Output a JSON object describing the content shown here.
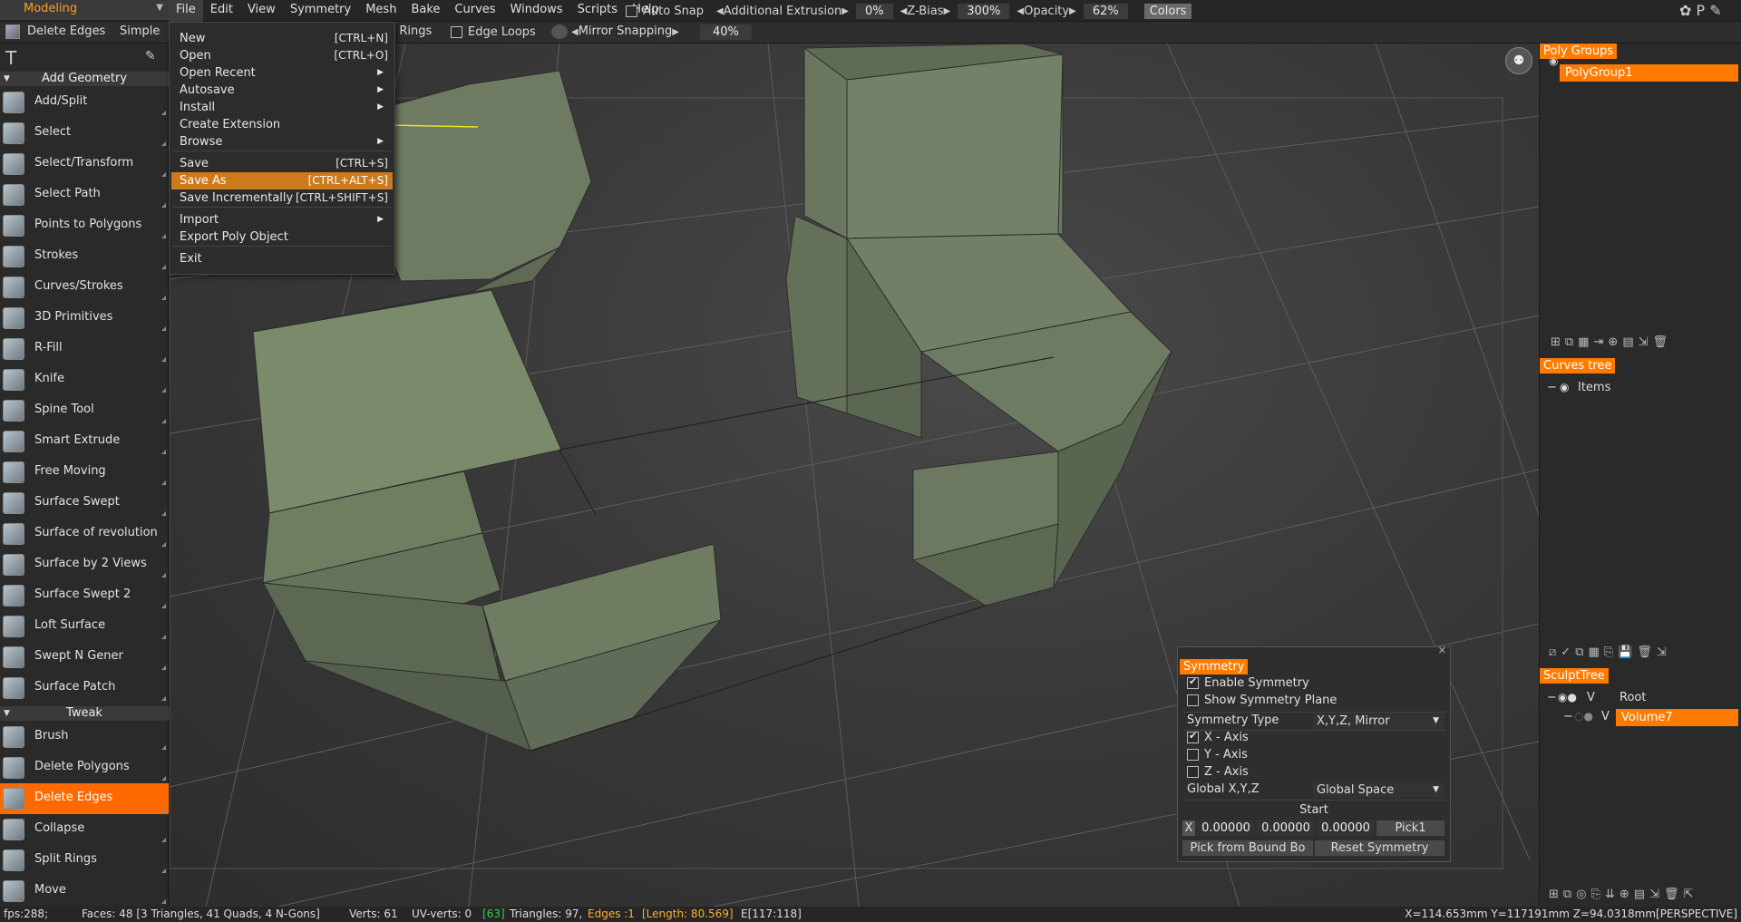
{
  "room": "Modeling",
  "menu": [
    "File",
    "Edit",
    "View",
    "Symmetry",
    "Mesh",
    "Bake",
    "Curves",
    "Windows",
    "Scripts",
    "Help"
  ],
  "top_options": {
    "auto_snap": "Auto Snap",
    "additional_extrusion": "Additional Extrusion",
    "additional_extrusion_value": "0%",
    "z_bias": "Z-Bias",
    "z_bias_value": "300%",
    "opacity": "Opacity",
    "opacity_value": "62%",
    "colors": "Colors"
  },
  "toolbar2": {
    "tool_name": "Delete Edges",
    "mode": "Simple",
    "edge_rings": "ge Rings",
    "edge_loops": "Edge Loops",
    "mirror_snapping": "Mirror Snapping",
    "mirror_snapping_value": "40%"
  },
  "file_menu": [
    {
      "label": "New",
      "shortcut": "[CTRL+N]"
    },
    {
      "label": "Open",
      "shortcut": "[CTRL+O]"
    },
    {
      "label": "Open Recent",
      "submenu": true
    },
    {
      "label": "Autosave",
      "submenu": true
    },
    {
      "label": "Install",
      "submenu": true
    },
    {
      "label": "Create Extension"
    },
    {
      "label": "Browse",
      "submenu": true
    },
    {
      "label": "Save",
      "shortcut": "[CTRL+S]"
    },
    {
      "label": "Save As",
      "shortcut": "[CTRL+ALT+S]",
      "highlighted": true
    },
    {
      "label": "Save Incrementally",
      "shortcut": "[CTRL+SHIFT+S]"
    },
    {
      "label": "Import",
      "submenu": true
    },
    {
      "label": "Export Poly Object"
    },
    {
      "label": "Exit"
    }
  ],
  "tools": {
    "section_add": "Add Geometry",
    "add_geometry": [
      "Add/Split",
      "Select",
      "Select/Transform",
      "Select Path",
      "Points to Polygons",
      "Strokes",
      "Curves/Strokes",
      "3D Primitives",
      "R-Fill",
      "Knife",
      "Spine Tool",
      "Smart Extrude",
      "Free Moving",
      "Surface Swept",
      "Surface of revolution",
      "Surface by 2 Views",
      "Surface Swept 2",
      "Loft Surface",
      "Swept N Gener",
      "Surface Patch"
    ],
    "section_tweak": "Tweak",
    "tweak": [
      "Brush",
      "Delete Polygons",
      "Delete Edges",
      "Collapse",
      "Split Rings",
      "Move"
    ],
    "selected": "Delete Edges"
  },
  "right": {
    "poly_groups_title": "Poly Groups",
    "poly_group_item": "PolyGroup1",
    "curves_tree_title": "Curves tree",
    "curves_item": "Items",
    "sculpt_tree_title": "SculptTree",
    "sculpt_root": "Root",
    "sculpt_volume": "Volume7",
    "v_label": "V"
  },
  "symmetry": {
    "title": "Symmetry",
    "enable": "Enable Symmetry",
    "show_plane": "Show Symmetry Plane",
    "type_label": "Symmetry Type",
    "type_value": "X,Y,Z, Mirror",
    "x_axis": "X  -  Axis",
    "y_axis": "Y  -  Axis",
    "z_axis": "Z  -  Axis",
    "global_label": "Global  X,Y,Z",
    "global_value": "Global  Space",
    "start": "Start",
    "x_btn": "X",
    "x0": "0.00000",
    "y0": "0.00000",
    "z0": "0.00000",
    "pick": "Pick1",
    "pick_bound": "Pick  from  Bound  Bo",
    "reset": "Reset  Symmetry"
  },
  "status": {
    "fps": "fps:288;",
    "faces": "Faces:  48  [3  Triangles,  41  Quads,  4  N-Gons]",
    "verts": "Verts:  61",
    "uvverts": "UV-verts:  0",
    "uvverts_green": "[63]",
    "triangles": "Triangles:  97,",
    "edges": "Edges  :1",
    "length": "[Length:  80.569]",
    "e_index": "E[117:118]",
    "coords": "X=114.653mm  Y=117191mm  Z=94.0318mm[PERSPECTIVE]"
  },
  "colors": {
    "accent": "#ff7b00",
    "menu_highlight": "#cc7a1c",
    "mesh": "#6c7860"
  }
}
